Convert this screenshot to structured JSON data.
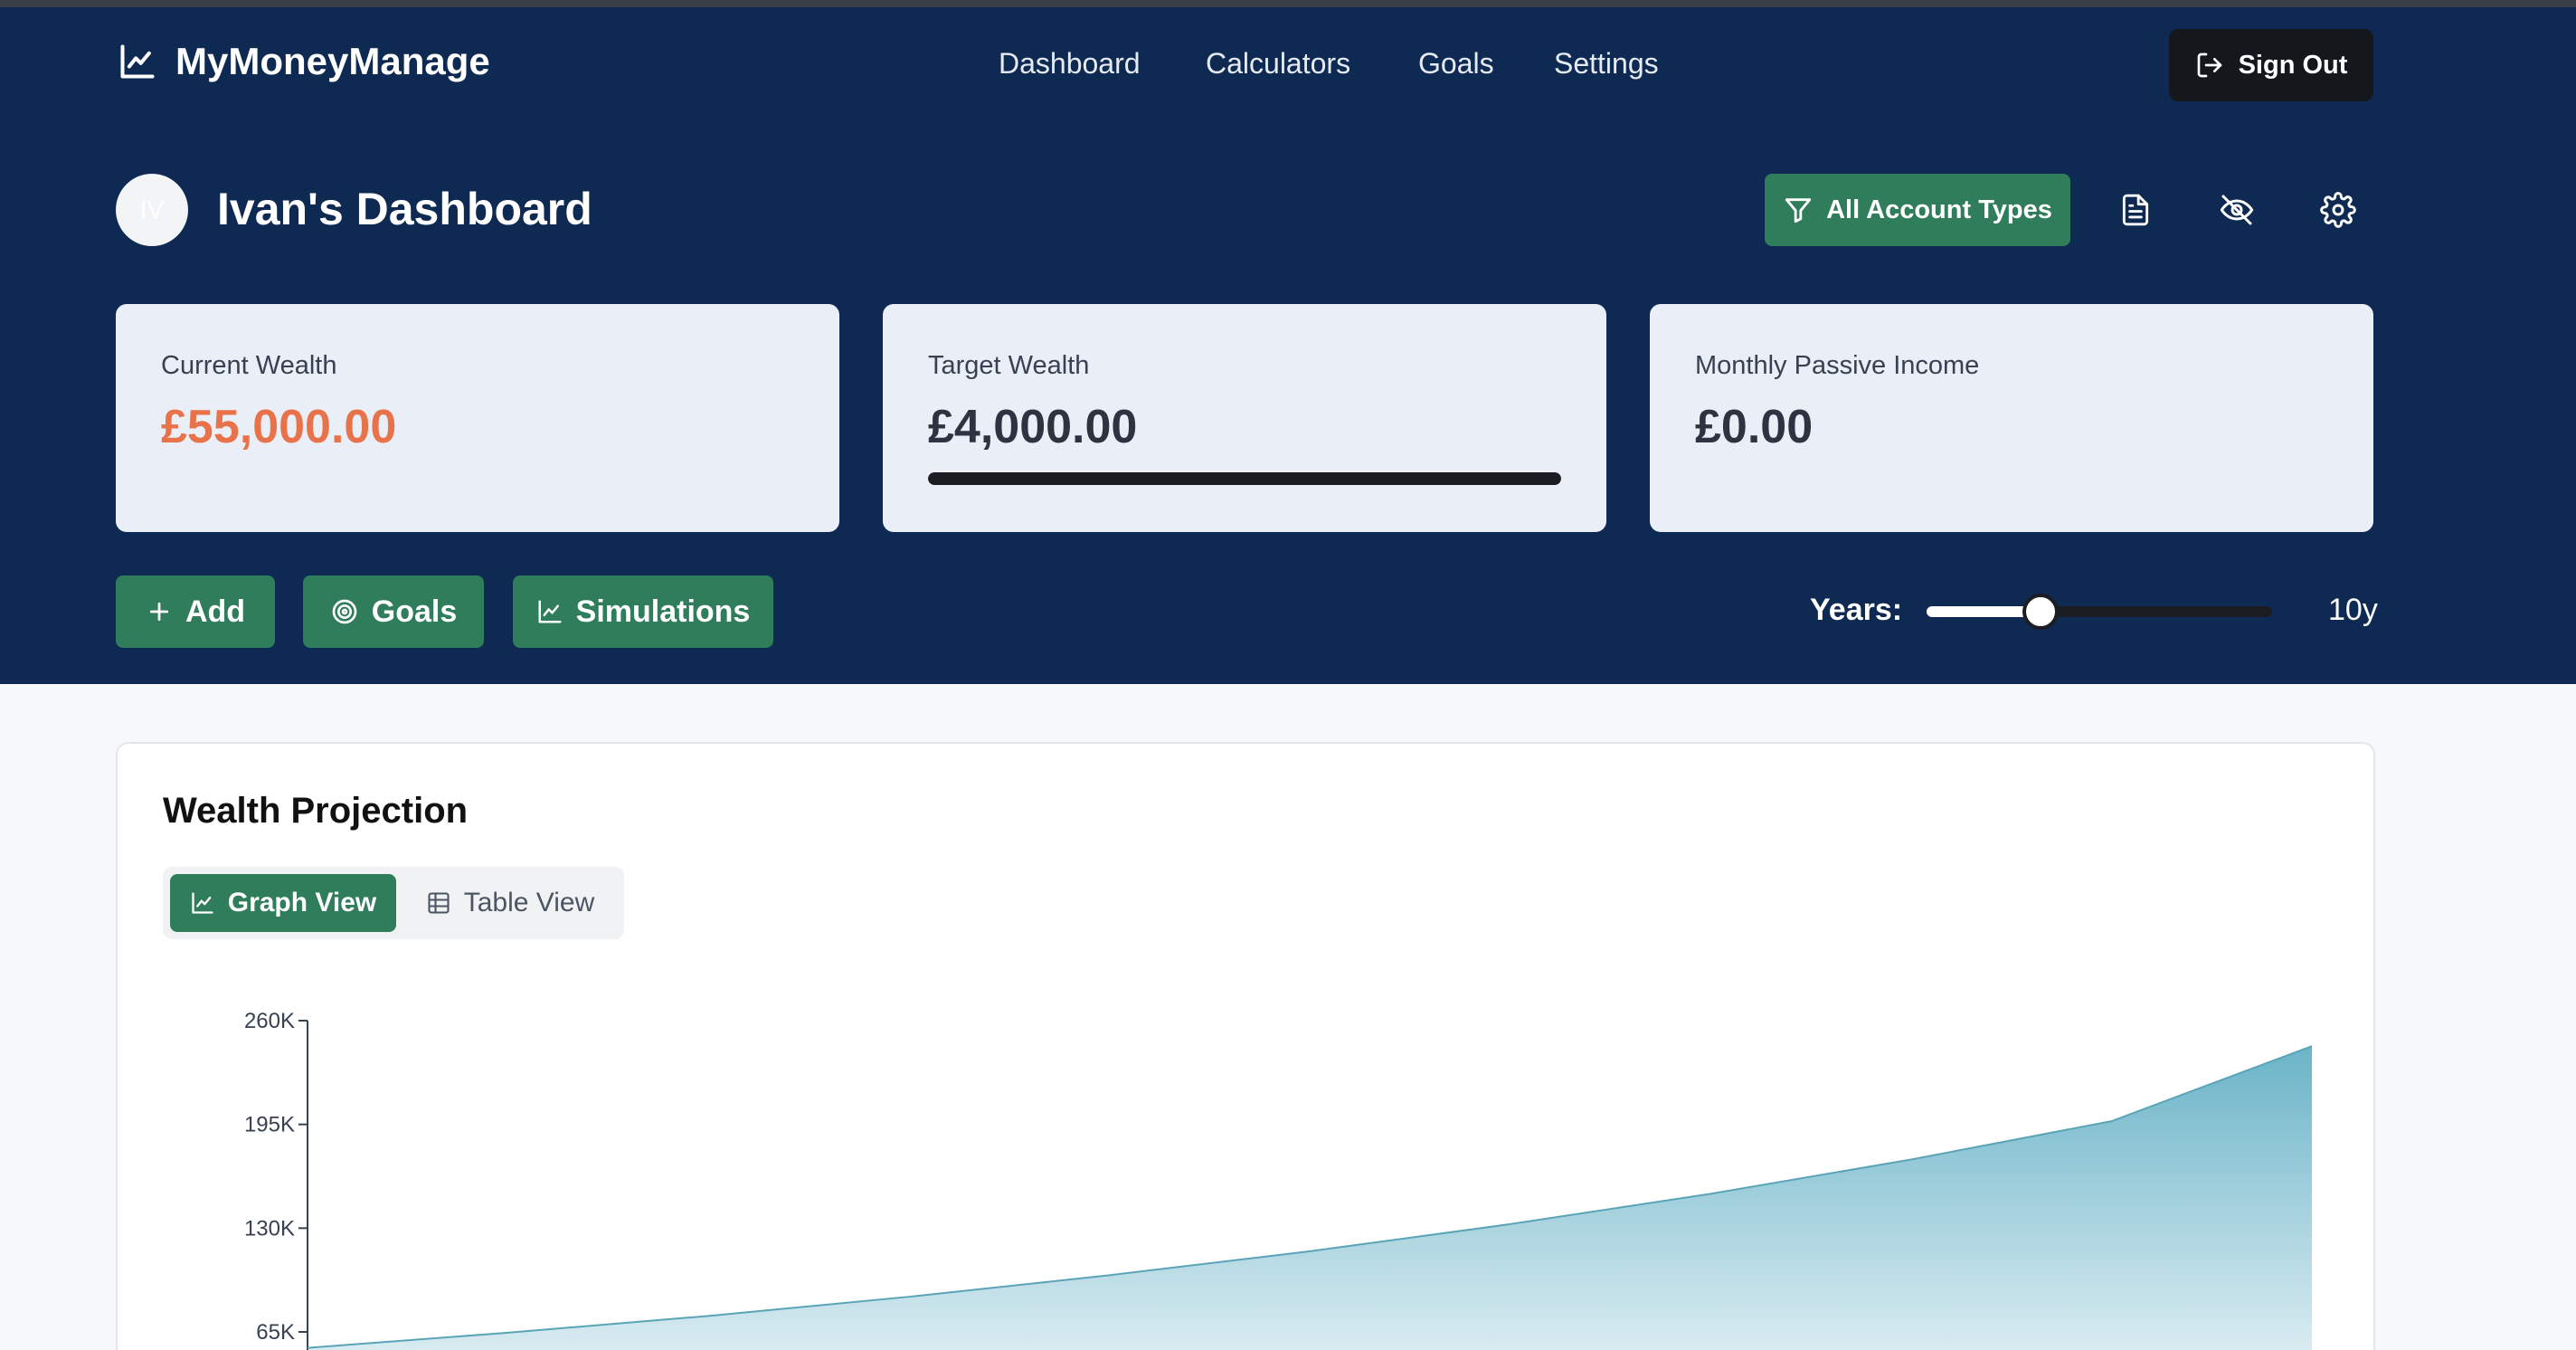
{
  "app": {
    "brand": "MyMoneyManage",
    "nav": [
      "Dashboard",
      "Calculators",
      "Goals",
      "Settings"
    ],
    "sign_out": "Sign Out"
  },
  "dashboard": {
    "avatar_initials": "IV",
    "title": "Ivan's Dashboard",
    "filter_label": "All Account Types",
    "icons": [
      "document-icon",
      "eye-off-icon",
      "gear-icon"
    ]
  },
  "cards": {
    "current_wealth": {
      "label": "Current Wealth",
      "value": "£55,000.00",
      "color": "#e8734a"
    },
    "target_wealth": {
      "label": "Target Wealth",
      "value": "£4,000.00",
      "progress": 1.0
    },
    "monthly_passive_income": {
      "label": "Monthly Passive Income",
      "value": "£0.00"
    }
  },
  "actions": {
    "add": "Add",
    "goals": "Goals",
    "simulations": "Simulations"
  },
  "years": {
    "label": "Years:",
    "value": "10y",
    "slider_fraction": 0.33
  },
  "projection": {
    "title": "Wealth Projection",
    "graph_view": "Graph View",
    "table_view": "Table View"
  },
  "colors": {
    "header": "#0f2a52",
    "accent": "#2f7d5b",
    "chart_fill": "#6bb4c8"
  },
  "chart_data": {
    "type": "area",
    "title": "",
    "xlabel": "",
    "ylabel": "",
    "yticks": [
      "260K",
      "195K",
      "130K",
      "65K"
    ],
    "ytick_values": [
      260000,
      195000,
      130000,
      65000
    ],
    "ylim": [
      0,
      260000
    ],
    "x": [
      0,
      1,
      2,
      3,
      4,
      5,
      6,
      7,
      8,
      9,
      10
    ],
    "series": [
      {
        "values": [
          55000,
          64500,
          75000,
          87000,
          100500,
          115500,
          132500,
          151500,
          173000,
          197000,
          244000
        ]
      }
    ]
  }
}
